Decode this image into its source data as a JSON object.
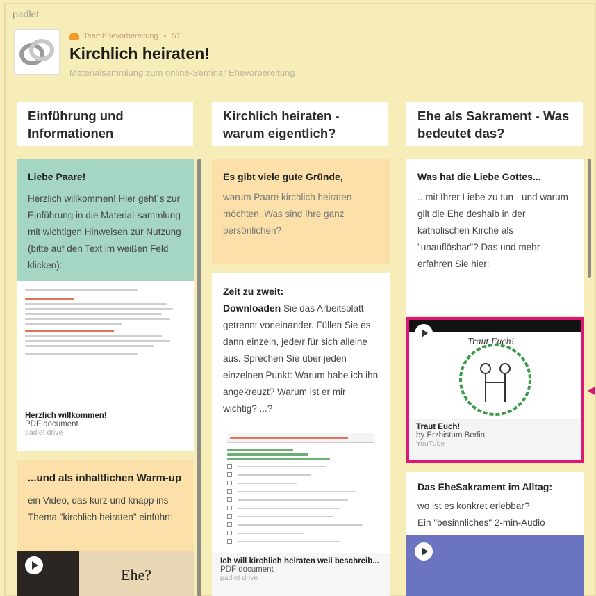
{
  "app": {
    "brand": "padlet"
  },
  "header": {
    "team": "TeamEhevorbereitung",
    "separator": "•",
    "age": "5T.",
    "title": "Kirchlich heiraten!",
    "subtitle": "Materialsammlung zum online-Seminar Ehevorbereitung"
  },
  "columns": [
    {
      "title": "Einführung und Informationen"
    },
    {
      "title": "Kirchlich heiraten - warum eigentlich?"
    },
    {
      "title": "Ehe als Sakrament - Was bedeutet das?"
    }
  ],
  "col1": {
    "card1": {
      "title": "Liebe Paare!",
      "body": "Herzlich willkommen! Hier geht´s zur Einführung in die Material-sammlung mit wichtigen Hinweisen zur Nutzung (bitte auf den Text im weißen Feld klicken):",
      "att_title": "Herzlich willkommen!",
      "att_type": "PDF document",
      "att_source": "padlet drive"
    },
    "card2": {
      "title": "...und als inhaltlichen Warm-up",
      "body": "ein Video, das kurz und knapp ins Thema \"kirchlich heiraten\" einführt:",
      "thumb_text": "Ehe?"
    }
  },
  "col2": {
    "card1": {
      "title": "Es gibt viele gute Gründe,",
      "body": "warum Paare kirchlich heiraten möchten. Was sind Ihre ganz persönlichen?"
    },
    "card2": {
      "title": "Zeit zu zweit:",
      "lead": "Downloaden",
      "body": " Sie das Arbeitsblatt getrennt voneinander. Füllen Sie es dann einzeln, jede/r für sich alleine aus. Sprechen Sie über jeden einzelnen Punkt: Warum habe ich ihn angekreuzt? Warum ist er mir wichtig? ...?",
      "att_title": "Ich will kirchlich heiraten weil beschreib...",
      "att_type": "PDF document",
      "att_source": "padlet drive"
    }
  },
  "col3": {
    "card1": {
      "title": "Was hat die Liebe Gottes...",
      "body": "...mit Ihrer Liebe zu tun - und warum gilt die Ehe deshalb in der katholischen Kirche als \"unauflösbar\"? Das und mehr erfahren Sie hier:"
    },
    "video": {
      "title": "Traut Euch!",
      "author": "by Erzbistum Berlin",
      "source": "YouTube",
      "thumb_text": "Traut Euch!"
    },
    "card2": {
      "title": "Das EheSakrament im Alltag:",
      "body1": "wo ist es konkret erlebbar?",
      "body2": "Ein \"besinnliches\" 2-min-Audio"
    }
  },
  "colors": {
    "highlight": "#e0157a",
    "green_card": "#a5d6c3",
    "orange_card": "#fbe1a9",
    "audio_card": "#6a74c0"
  }
}
